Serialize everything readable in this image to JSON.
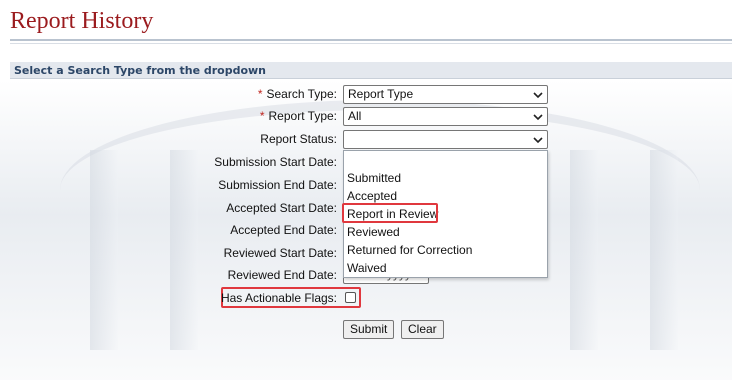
{
  "page": {
    "title": "Report History"
  },
  "section": {
    "heading": "Select a Search Type from the dropdown"
  },
  "form": {
    "required_marker": "*",
    "search_type": {
      "label": "Search Type:",
      "value": "Report Type"
    },
    "report_type": {
      "label": "Report Type:",
      "value": "All"
    },
    "report_status": {
      "label": "Report Status:",
      "value": ""
    },
    "submission_start_date": {
      "label": "Submission Start Date:"
    },
    "submission_end_date": {
      "label": "Submission End Date:"
    },
    "accepted_start_date": {
      "label": "Accepted Start Date:"
    },
    "accepted_end_date": {
      "label": "Accepted End Date:"
    },
    "reviewed_start_date": {
      "label": "Reviewed Start Date:"
    },
    "reviewed_end_date": {
      "label": "Reviewed End Date:",
      "placeholder_visible": "mm/dd/yyyy"
    },
    "has_actionable_flags": {
      "label": "Has Actionable Flags:",
      "checked": false
    },
    "status_options": [
      "",
      "Submitted",
      "Accepted",
      "Report in Review",
      "Reviewed",
      "Returned for Correction",
      "Waived"
    ],
    "highlighted_option": "Report in Review",
    "submit_label": "Submit",
    "clear_label": "Clear"
  },
  "colors": {
    "title": "#9b1b1e",
    "section_text": "#2c4667",
    "highlight_box": "#e0383e"
  }
}
